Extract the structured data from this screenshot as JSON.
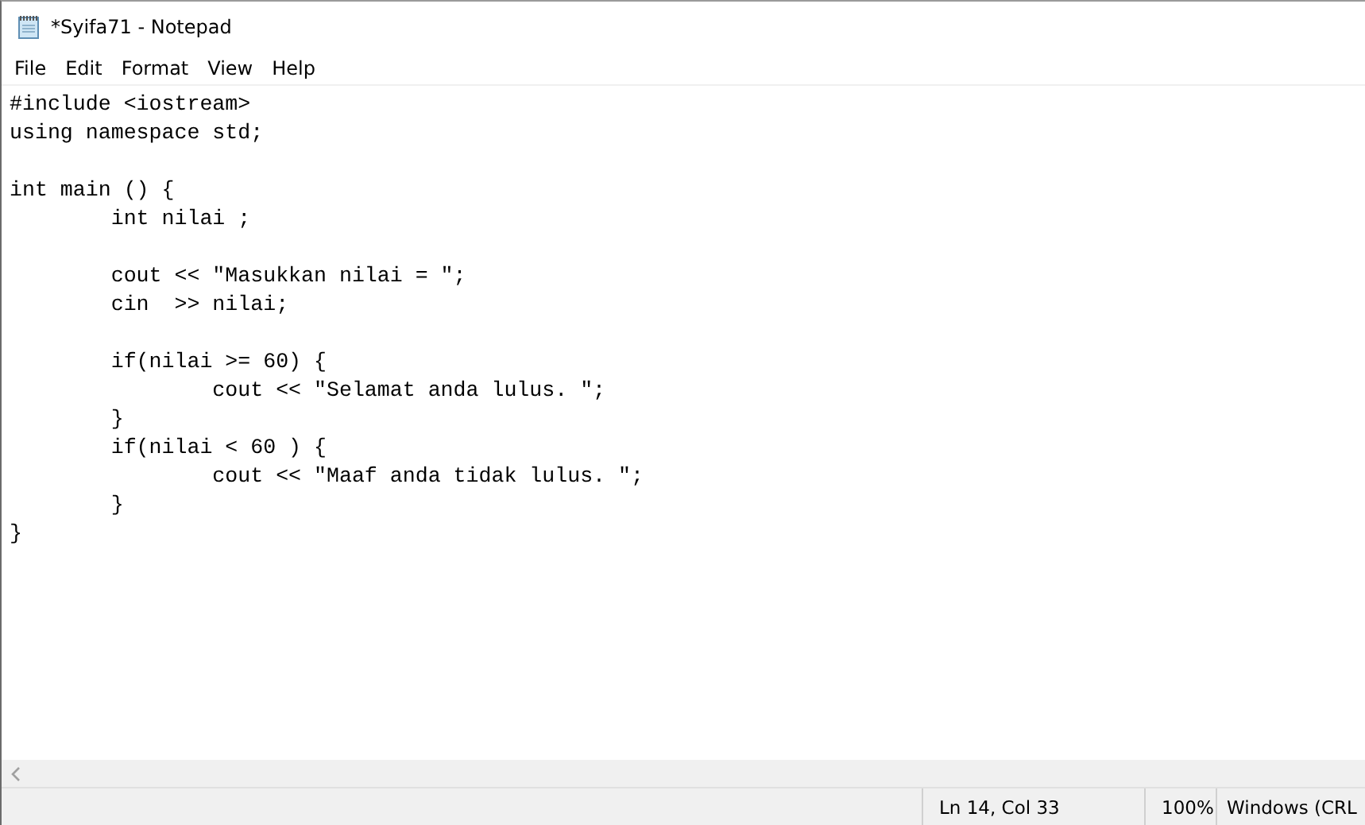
{
  "window": {
    "title": "*Syifa71 - Notepad"
  },
  "menu": [
    "File",
    "Edit",
    "Format",
    "View",
    "Help"
  ],
  "editor": {
    "text": "#include <iostream>\nusing namespace std;\n\nint main () {\n\tint nilai ;\n\t\n\tcout << \"Masukkan nilai = \";\n\tcin  >> nilai;\n\t\n\tif(nilai >= 60) {\n\t\tcout << \"Selamat anda lulus. \";\n\t}\n\tif(nilai < 60 ) {\n\t\tcout << \"Maaf anda tidak lulus. \";\n\t}\n}"
  },
  "status_bar": {
    "position": "Ln 14, Col 33",
    "zoom": "100%",
    "line_ending": "Windows (CRL"
  }
}
